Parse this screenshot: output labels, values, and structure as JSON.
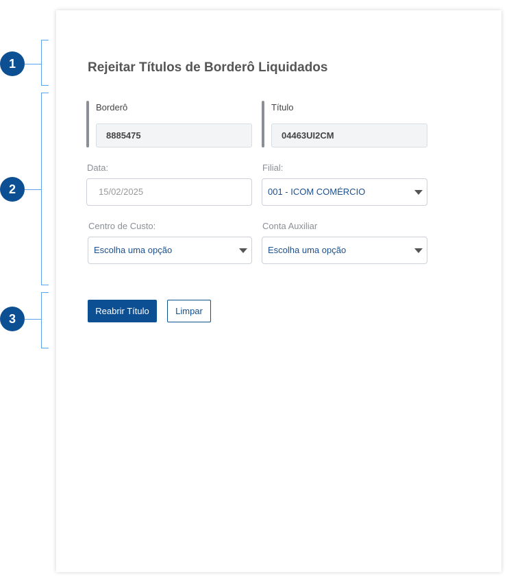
{
  "annotations": [
    "1",
    "2",
    "3"
  ],
  "form": {
    "title": "Rejeitar Títulos de Borderô Liquidados",
    "bordero": {
      "label": "Borderô",
      "value": "8885475"
    },
    "titulo": {
      "label": "Título",
      "value": "04463UI2CM"
    },
    "data": {
      "label": "Data:",
      "value": "15/02/2025"
    },
    "filial": {
      "label": "Filial:",
      "value": "001 - ICOM COMÉRCIO"
    },
    "centro_custo": {
      "label": "Centro de Custo:",
      "value": "Escolha uma opção"
    },
    "conta_auxiliar": {
      "label": "Conta Auxiliar",
      "value": "Escolha uma opção"
    },
    "reopen_label": "Reabrir Título",
    "clear_label": "Limpar"
  },
  "colors": {
    "primary": "#0c4f93",
    "bracket": "#5aa3ee"
  }
}
